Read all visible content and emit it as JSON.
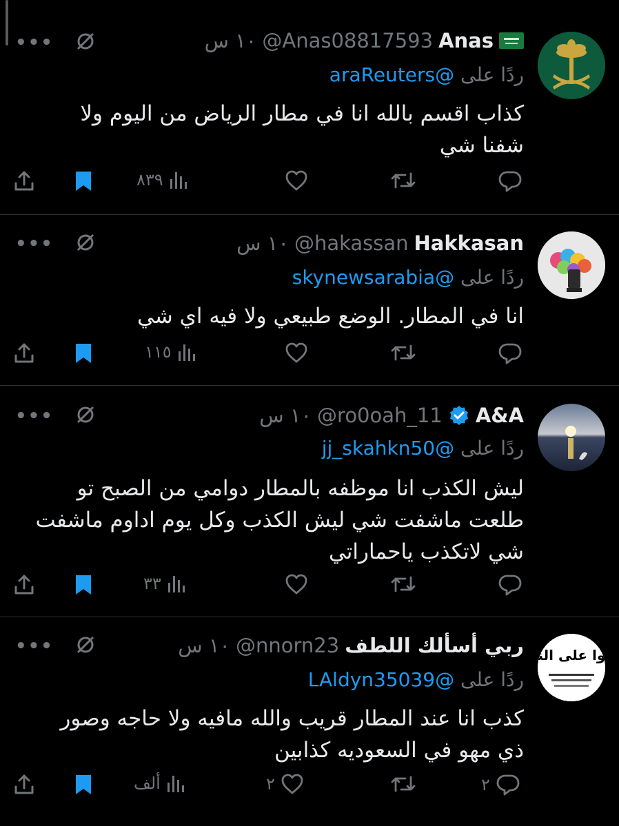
{
  "tweets": [
    {
      "name": "Anas",
      "flag_text": "لا إله إلا الله",
      "handle": "@Anas08817593",
      "time": "١٠ س",
      "reply_prefix": "ردًا على",
      "reply_to": "@araReuters",
      "body": "كذاب اقسم بالله انا في مطار الرياض من اليوم ولا شفنا شي",
      "replies": "",
      "retweets": "",
      "likes": "",
      "views": "٨٣٩",
      "verified": false,
      "bookmarked": true
    },
    {
      "name": "Hakkasan",
      "handle": "@hakassan",
      "time": "١٠ س",
      "reply_prefix": "ردًا على",
      "reply_to": "@skynewsarabia",
      "body": "انا في المطار. الوضع طبيعي  ولا فيه اي شي",
      "replies": "",
      "retweets": "",
      "likes": "",
      "views": "١١٥",
      "verified": false,
      "bookmarked": true
    },
    {
      "name": "A&A",
      "handle": "@ro0oah_11",
      "time": "١٠ س",
      "reply_prefix": "ردًا على",
      "reply_to": "@jj_skahkn50",
      "body": "ليش الكذب انا موظفه بالمطار دوامي من الصبح تو طلعت ماشفت شي ليش الكذب وكل يوم اداوم ماشفت شي لاتكذب ياحماراتي",
      "replies": "",
      "retweets": "",
      "likes": "",
      "views": "٣٣",
      "verified": true,
      "bookmarked": true
    },
    {
      "name": "ربي أسألك اللطف",
      "handle": "@nnorn23",
      "time": "١٠ س",
      "reply_prefix": "ردًا على",
      "reply_to": "@LAldyn35039",
      "body": "كذب  انا عند المطار قريب والله مافيه ولا حاجه   وصور ذي  مهو في السعوديه كذابين",
      "avatar_text": "صلوا على النبي",
      "replies": "٢",
      "retweets": "",
      "likes": "٢",
      "views": "ألف",
      "verified": false,
      "bookmarked": true
    }
  ],
  "colors": {
    "background": "#000000",
    "text": "#e7e9ea",
    "muted": "#71767b",
    "accent": "#1d9bf0",
    "divider": "#2f3336"
  },
  "icons": [
    "reply-icon",
    "retweet-icon",
    "like-icon",
    "views-icon",
    "bookmark-icon",
    "share-icon",
    "grok-icon",
    "more-icon",
    "verified-icon",
    "saudi-flag-icon"
  ]
}
